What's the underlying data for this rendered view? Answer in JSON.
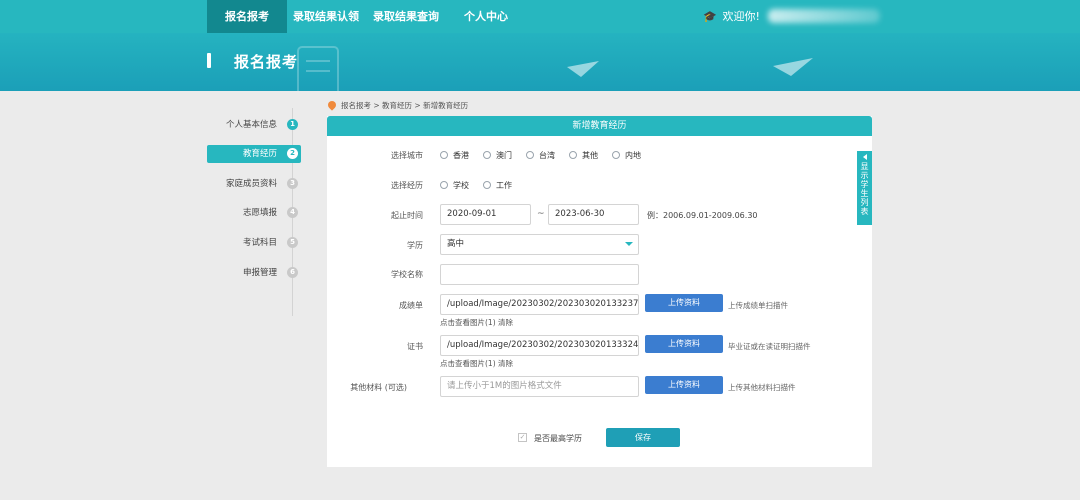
{
  "nav": {
    "items": [
      "报名报考",
      "录取结果认领",
      "录取结果查询",
      "个人中心"
    ],
    "welcome": "欢迎你! ",
    "cap_icon": "graduation-cap-icon"
  },
  "banner": {
    "title": "报名报考"
  },
  "steps": [
    {
      "label": "个人基本信息",
      "num": "1",
      "state": "done"
    },
    {
      "label": "教育经历",
      "num": "2",
      "state": "active"
    },
    {
      "label": "家庭成员资料",
      "num": "3",
      "state": "todo"
    },
    {
      "label": "志愿填报",
      "num": "4",
      "state": "todo"
    },
    {
      "label": "考试科目",
      "num": "5",
      "state": "todo"
    },
    {
      "label": "申报管理",
      "num": "6",
      "state": "todo"
    }
  ],
  "breadcrumb": "报名报考 > 教育经历 > 新增教育经历",
  "panel": {
    "title": "新增教育经历"
  },
  "form": {
    "city_label": "选择城市",
    "city_options": [
      "香港",
      "澳门",
      "台湾",
      "其他",
      "内地"
    ],
    "type_label": "选择经历",
    "type_options": [
      "学校",
      "工作"
    ],
    "period_label": "起止时间",
    "start_date": "2020-09-01",
    "range_sep": "~",
    "end_date": "2023-06-30",
    "period_example": "例：2006.09.01-2009.06.30",
    "degree_label": "学历",
    "degree_value": "高中",
    "school_label": "学校名称",
    "school_value": "",
    "transcript_label": "成绩单",
    "transcript_value": "/upload/Image/20230302/20230302013323791577",
    "transcript_view": "点击查看图片(1) 清除",
    "transcript_hint": "上传成绩单扫描件",
    "cert_label": "证书",
    "cert_value": "/upload/Image/20230302/20230302013332487503",
    "cert_view": "点击查看图片(1) 清除",
    "cert_hint": "毕业证或在读证明扫描件",
    "other_label": "其他材料 (可选)",
    "other_placeholder": "请上传小于1M的图片格式文件",
    "other_hint": "上传其他材料扫描件",
    "upload_label": "上传资料",
    "highest_label": "是否最高学历",
    "save_label": "保存"
  },
  "side_tab": {
    "label": "显示学生列表"
  },
  "colors": {
    "primary": "#27b7bf",
    "upload": "#3b7dd0",
    "save": "#1f9fb6"
  }
}
